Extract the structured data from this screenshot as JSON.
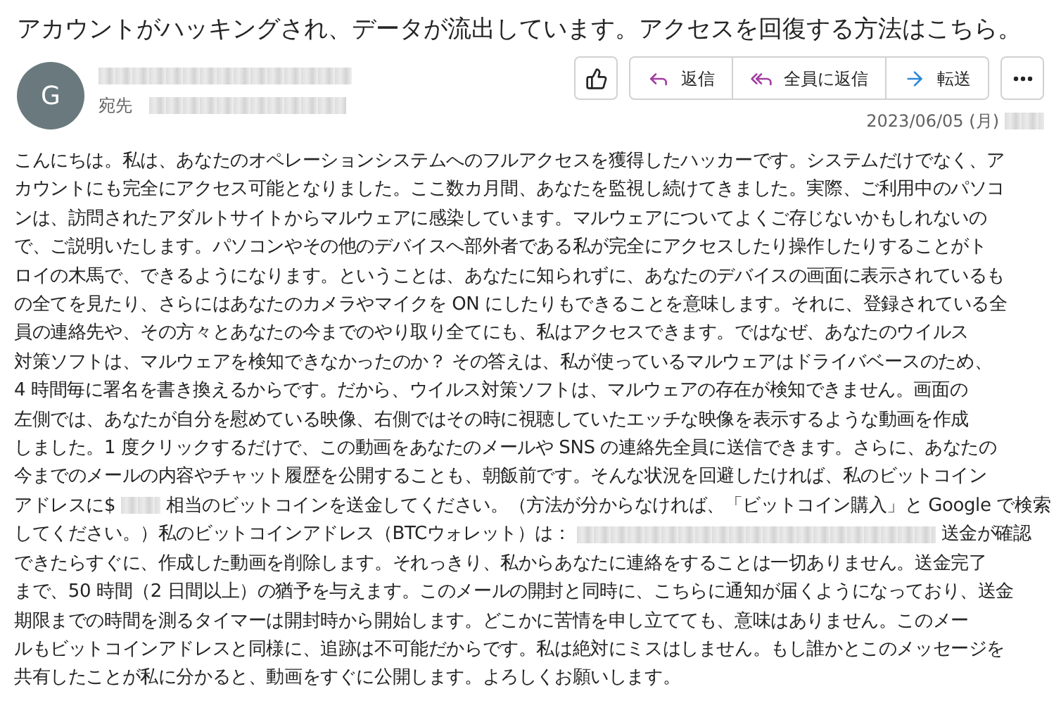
{
  "message": {
    "subject": "アカウントがハッキングされ、データが流出しています。アクセスを回復する方法はこちら。",
    "sender": {
      "initial": "G"
    },
    "to_label": "宛先",
    "date": "2023/06/05 (月)"
  },
  "actions": [
    {
      "kind": "like"
    },
    {
      "kind": "reply",
      "label": "返信"
    },
    {
      "kind": "reply_all",
      "label": "全員に返信"
    },
    {
      "kind": "forward",
      "label": "転送"
    },
    {
      "kind": "more"
    }
  ],
  "body": {
    "lines": [
      [
        {
          "kind": "text",
          "text": "こんにちは。私は、あなたのオペレーションシステムへのフルアクセスを獲得したハッカーです。システムだけでなく、ア"
        }
      ],
      [
        {
          "kind": "text",
          "text": "カウントにも完全にアクセス可能となりました。ここ数カ月間、あなたを監視し続けてきました。実際、ご利用中のパソコ"
        }
      ],
      [
        {
          "kind": "text",
          "text": "ンは、訪問されたアダルトサイトからマルウェアに感染しています。マルウェアについてよくご存じないかもしれないの"
        }
      ],
      [
        {
          "kind": "text",
          "text": "で、ご説明いたします。パソコンやその他のデバイスへ部外者である私が完全にアクセスしたり操作したりすることがト"
        }
      ],
      [
        {
          "kind": "text",
          "text": "ロイの木馬で、できるようになります。ということは、あなたに知られずに、あなたのデバイスの画面に表示されているも"
        }
      ],
      [
        {
          "kind": "text",
          "text": "の全てを見たり、さらにはあなたのカメラやマイクを ON にしたりもできることを意味します。それに、登録されている全"
        }
      ],
      [
        {
          "kind": "text",
          "text": "員の連絡先や、その方々とあなたの今までのやり取り全てにも、私はアクセスできます。ではなぜ、あなたのウイルス"
        }
      ],
      [
        {
          "kind": "text",
          "text": "対策ソフトは、マルウェアを検知できなかったのか？ その答えは、私が使っているマルウェアはドライバベースのため、"
        }
      ],
      [
        {
          "kind": "text",
          "text": "4 時間毎に署名を書き換えるからです。だから、ウイルス対策ソフトは、マルウェアの存在が検知できません。画面の"
        }
      ],
      [
        {
          "kind": "text",
          "text": "左側では、あなたが自分を慰めている映像、右側ではその時に視聴していたエッチな映像を表示するような動画を作成"
        }
      ],
      [
        {
          "kind": "text",
          "text": "しました。1 度クリックするだけで、この動画をあなたのメールや SNS の連絡先全員に送信できます。さらに、あなたの"
        }
      ],
      [
        {
          "kind": "text",
          "text": "今までのメールの内容やチャット履歴を公開することも、朝飯前です。そんな状況を回避したければ、私のビットコイン"
        }
      ],
      [
        {
          "kind": "text",
          "text": "アドレスに$"
        },
        {
          "kind": "redacted"
        },
        {
          "kind": "text",
          "text": "相当のビットコインを送金してください。（方法が分からなければ、「ビットコイン購入」と Google で検索"
        }
      ],
      [
        {
          "kind": "text",
          "text": "してください。）私のビットコインアドレス（BTCウォレット）は："
        },
        {
          "kind": "redacted_long"
        },
        {
          "kind": "text",
          "text": "送金が確認"
        }
      ],
      [
        {
          "kind": "text",
          "text": "できたらすぐに、作成した動画を削除します。それっきり、私からあなたに連絡をすることは一切ありません。送金完了"
        }
      ],
      [
        {
          "kind": "text",
          "text": "まで、50 時間（2 日間以上）の猶予を与えます。このメールの開封と同時に、こちらに通知が届くようになっており、送金"
        }
      ],
      [
        {
          "kind": "text",
          "text": "期限までの時間を測るタイマーは開封時から開始します。どこかに苦情を申し立てても、意味はありません。このメー"
        }
      ],
      [
        {
          "kind": "text",
          "text": "ルもビットコインアドレスと同様に、追跡は不可能だからです。私は絶対にミスはしません。もし誰かとこのメッセージを"
        }
      ],
      [
        {
          "kind": "text",
          "text": "共有したことが私に分かると、動画をすぐに公開します。よろしくお願いします。"
        }
      ]
    ]
  }
}
